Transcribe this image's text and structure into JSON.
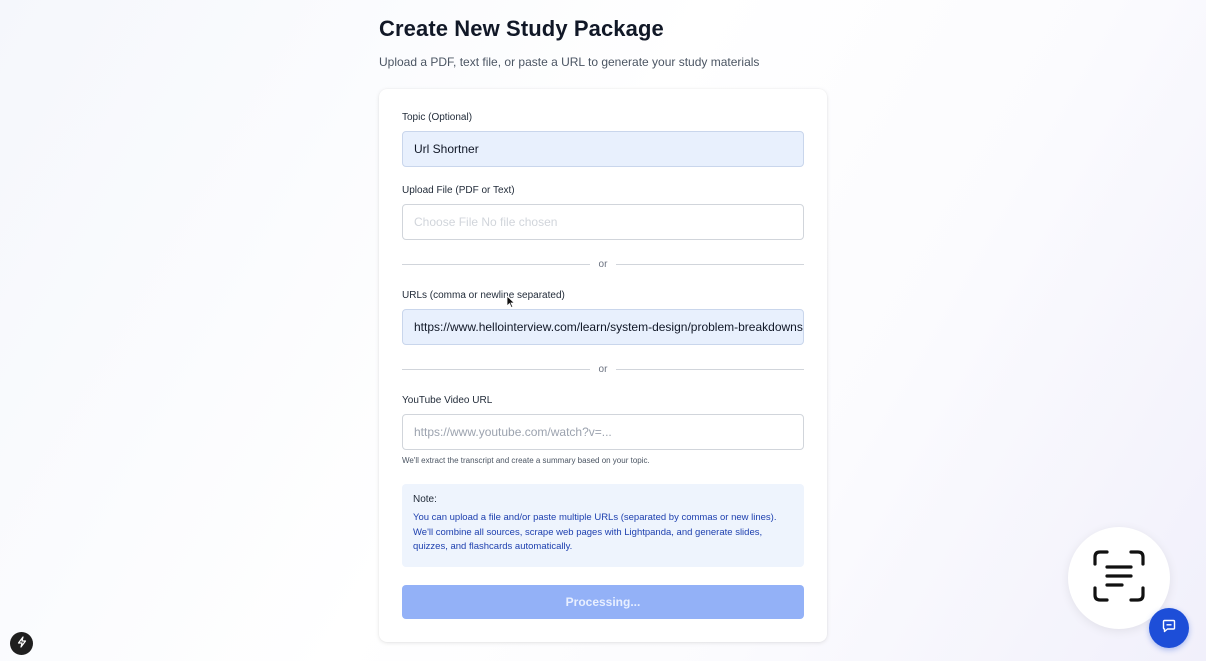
{
  "header": {
    "title": "Create New Study Package",
    "subtitle": "Upload a PDF, text file, or paste a URL to generate your study materials"
  },
  "form": {
    "topic_label": "Topic (Optional)",
    "topic_value": "Url Shortner",
    "file_label": "Upload File (PDF or Text)",
    "file_button_text": "Choose File",
    "file_status_text": "No file chosen",
    "or_text": "or",
    "urls_label": "URLs (comma or newline separated)",
    "urls_value": "https://www.hellointerview.com/learn/system-design/problem-breakdowns/bitly",
    "youtube_label": "YouTube Video URL",
    "youtube_placeholder": "https://www.youtube.com/watch?v=...",
    "youtube_help": "We'll extract the transcript and create a summary based on your topic.",
    "note_title": "Note:",
    "note_body": "You can upload a file and/or paste multiple URLs (separated by commas or new lines). We'll combine all sources, scrape web pages with Lightpanda, and generate slides, quizzes, and flashcards automatically.",
    "submit_label": "Processing..."
  },
  "widgets": {
    "scan_icon": "text-scan-icon",
    "chat_icon": "chat-icon",
    "bolt_icon": "bolt-icon"
  },
  "colors": {
    "accent": "#1d4ed8",
    "submit_disabled": "#93b1f7",
    "filled_input": "#e8f0fd",
    "note_bg": "#eef4fd"
  }
}
